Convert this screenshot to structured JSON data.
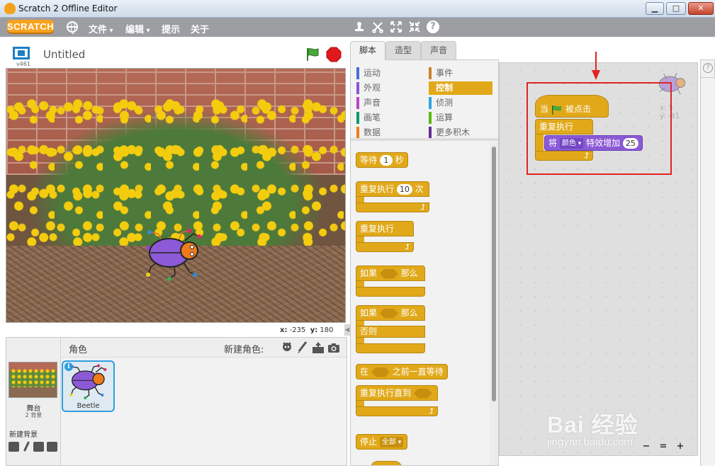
{
  "window": {
    "title": "Scratch 2 Offline Editor",
    "min_glyph": "▁",
    "max_glyph": "□",
    "close_glyph": "✕"
  },
  "menubar": {
    "logo_text": "SCRATCH",
    "items": [
      "文件",
      "编辑",
      "提示",
      "关于"
    ],
    "help_glyph": "?"
  },
  "stage": {
    "project_title": "Untitled",
    "version": "v461",
    "coords": {
      "x_label": "x:",
      "x": "-235",
      "y_label": "y:",
      "y": "180"
    }
  },
  "sprites": {
    "header_label": "角色",
    "new_sprite_label": "新建角色:",
    "stage_label": "舞台",
    "backdrop_count": "2 背景",
    "new_backdrop_label": "新建背景",
    "items": [
      {
        "name": "Beetle",
        "info_glyph": "i"
      }
    ]
  },
  "tabs": [
    "脚本",
    "造型",
    "声音"
  ],
  "categories": {
    "left": [
      {
        "label": "运动",
        "color": "#4a6cd4"
      },
      {
        "label": "外观",
        "color": "#8a55d7"
      },
      {
        "label": "声音",
        "color": "#bb42c3"
      },
      {
        "label": "画笔",
        "color": "#0e9a6c"
      },
      {
        "label": "数据",
        "color": "#ee7d16"
      }
    ],
    "right": [
      {
        "label": "事件",
        "color": "#c88330"
      },
      {
        "label": "控制",
        "color": "#e1a91a"
      },
      {
        "label": "侦测",
        "color": "#2ca5e2"
      },
      {
        "label": "运算",
        "color": "#5cb712"
      },
      {
        "label": "更多积木",
        "color": "#632d99"
      }
    ],
    "active": "控制"
  },
  "palette_blocks": {
    "wait": {
      "label": "等待",
      "value": "1",
      "suffix": "秒"
    },
    "repeat": {
      "label": "重复执行",
      "value": "10",
      "suffix": "次"
    },
    "forever": {
      "label": "重复执行"
    },
    "if_then": {
      "label": "如果",
      "suffix": "那么"
    },
    "if_else": {
      "label": "如果",
      "suffix": "那么",
      "else": "否则"
    },
    "wait_until": {
      "label": "在",
      "suffix": "之前一直等待"
    },
    "repeat_until": {
      "label": "重复执行直到"
    },
    "stop": {
      "label": "停止",
      "option": "全部"
    }
  },
  "script": {
    "hat": {
      "prefix": "当",
      "suffix": "被点击"
    },
    "forever": {
      "label": "重复执行"
    },
    "change_effect": {
      "prefix": "将",
      "effect": "颜色",
      "suffix": "特效增加",
      "value": "25"
    },
    "ghost_coords": {
      "x": "x: 5",
      "y": "y: -81"
    }
  },
  "zoom": {
    "out": "−",
    "reset": "=",
    "in": "+"
  },
  "watermark": {
    "logo": "Bai 经验",
    "url": "jingyan.baidu.com"
  },
  "colors": {
    "control": "#e1a91a",
    "looks": "#8c5ad6",
    "menubar": "#9c9ea2",
    "highlight": "#e02424"
  }
}
